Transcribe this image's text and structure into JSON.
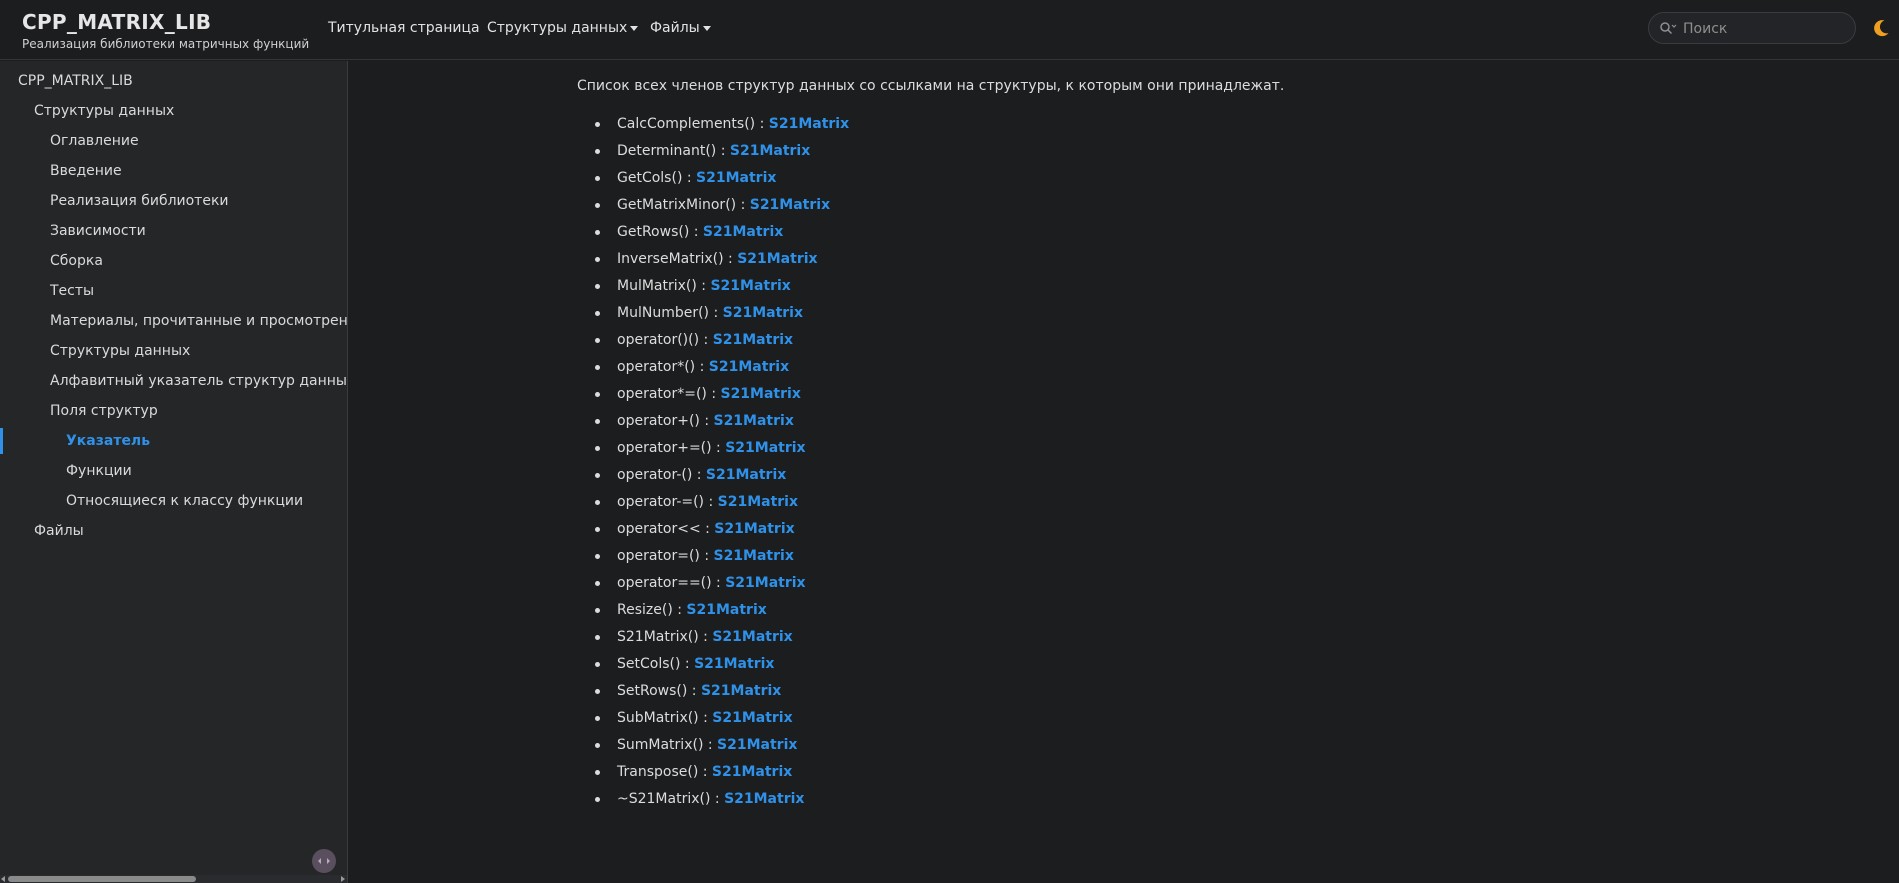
{
  "header": {
    "project_name": "CPP_MATRIX_LIB",
    "project_brief": "Реализация библиотеки матричных функций",
    "menu": {
      "main_page": "Титульная страница",
      "classes": "Структуры данных",
      "files": "Файлы"
    },
    "search_placeholder": "Поиск",
    "accent_color": "#2f91e8",
    "theme_icon": "moon-icon"
  },
  "sidebar": {
    "items": [
      {
        "label": "CPP_MATRIX_LIB"
      },
      {
        "label": "Структуры данных"
      },
      {
        "label": "Оглавление"
      },
      {
        "label": "Введение"
      },
      {
        "label": "Реализация библиотеки"
      },
      {
        "label": "Зависимости"
      },
      {
        "label": "Сборка"
      },
      {
        "label": "Тесты"
      },
      {
        "label": "Материалы, прочитанные и просмотренные"
      },
      {
        "label": "Структуры данных"
      },
      {
        "label": "Алфавитный указатель структур данных"
      },
      {
        "label": "Поля структур"
      },
      {
        "label": "Указатель"
      },
      {
        "label": "Функции"
      },
      {
        "label": "Относящиеся к классу функции"
      },
      {
        "label": "Файлы"
      }
    ],
    "selected_index": 12
  },
  "main": {
    "intro": "Список всех членов структур данных со ссылками на структуры, к которым они принадлежат.",
    "members": [
      {
        "name": "CalcComplements() : ",
        "link": "S21Matrix"
      },
      {
        "name": "Determinant() : ",
        "link": "S21Matrix"
      },
      {
        "name": "GetCols() : ",
        "link": "S21Matrix"
      },
      {
        "name": "GetMatrixMinor() : ",
        "link": "S21Matrix"
      },
      {
        "name": "GetRows() : ",
        "link": "S21Matrix"
      },
      {
        "name": "InverseMatrix() : ",
        "link": "S21Matrix"
      },
      {
        "name": "MulMatrix() : ",
        "link": "S21Matrix"
      },
      {
        "name": "MulNumber() : ",
        "link": "S21Matrix"
      },
      {
        "name": "operator()() : ",
        "link": "S21Matrix"
      },
      {
        "name": "operator*() : ",
        "link": "S21Matrix"
      },
      {
        "name": "operator*=() : ",
        "link": "S21Matrix"
      },
      {
        "name": "operator+() : ",
        "link": "S21Matrix"
      },
      {
        "name": "operator+=() : ",
        "link": "S21Matrix"
      },
      {
        "name": "operator-() : ",
        "link": "S21Matrix"
      },
      {
        "name": "operator-=() : ",
        "link": "S21Matrix"
      },
      {
        "name": "operator<< : ",
        "link": "S21Matrix"
      },
      {
        "name": "operator=() : ",
        "link": "S21Matrix"
      },
      {
        "name": "operator==() : ",
        "link": "S21Matrix"
      },
      {
        "name": "Resize() : ",
        "link": "S21Matrix"
      },
      {
        "name": "S21Matrix() : ",
        "link": "S21Matrix"
      },
      {
        "name": "SetCols() : ",
        "link": "S21Matrix"
      },
      {
        "name": "SetRows() : ",
        "link": "S21Matrix"
      },
      {
        "name": "SubMatrix() : ",
        "link": "S21Matrix"
      },
      {
        "name": "SumMatrix() : ",
        "link": "S21Matrix"
      },
      {
        "name": "Transpose() : ",
        "link": "S21Matrix"
      },
      {
        "name": "~S21Matrix() : ",
        "link": "S21Matrix"
      }
    ]
  }
}
